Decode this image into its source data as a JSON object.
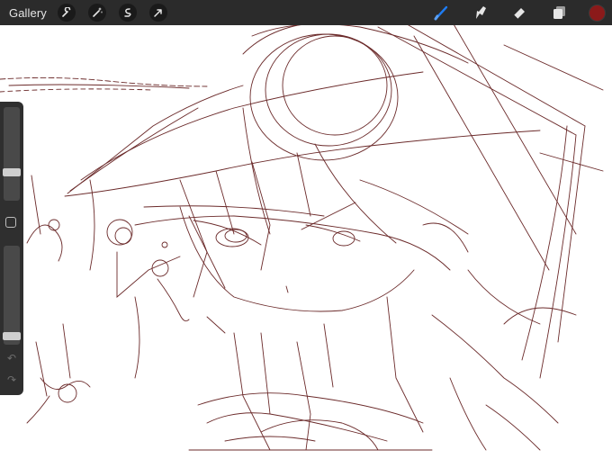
{
  "toolbar": {
    "gallery_label": "Gallery",
    "left_tools": [
      {
        "icon": "wrench-icon"
      },
      {
        "icon": "magic-wand-icon"
      },
      {
        "icon": "selection-icon"
      },
      {
        "icon": "transform-arrow-icon"
      }
    ],
    "right_tools": [
      {
        "icon": "brush-icon",
        "active": true
      },
      {
        "icon": "smudge-icon"
      },
      {
        "icon": "eraser-icon"
      },
      {
        "icon": "layers-icon"
      }
    ],
    "active_color": "#8b1a1a"
  },
  "sidebar": {
    "brush_size_level": 0.72,
    "opacity_level": 0.95,
    "undo_icon": "undo-icon",
    "redo_icon": "redo-icon"
  },
  "colors": {
    "toolbar_bg": "#2b2b2b",
    "accent_blue": "#1e7cf2",
    "sketch_stroke": "#6b2a2a"
  }
}
